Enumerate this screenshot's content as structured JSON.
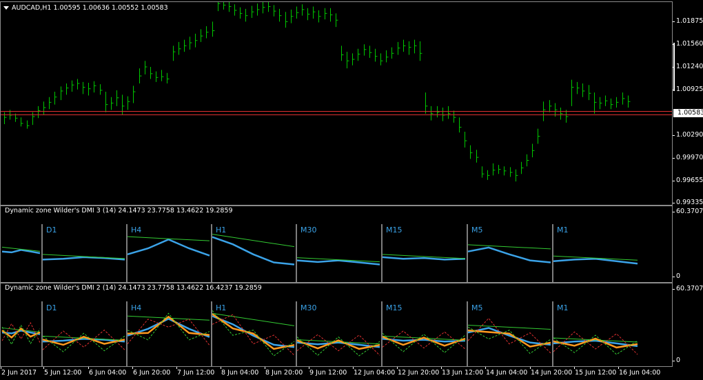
{
  "main": {
    "title": "AUDCAD,H1  1.00595 1.00636 1.00552 1.00583",
    "price_ticks": [
      "1.01875",
      "1.01560",
      "1.01240",
      "1.00925",
      "1.00290",
      "0.99970",
      "0.99655",
      "0.99335"
    ],
    "current_price": "1.00583",
    "candle_color": "#00c800",
    "level_line_color": "#e03030",
    "bars": [
      [
        1.0036,
        1.0052,
        1.0045
      ],
      [
        1.0042,
        1.0055,
        1.0048
      ],
      [
        1.0039,
        1.005,
        1.0044
      ],
      [
        1.0033,
        1.0045,
        1.0037
      ],
      [
        1.003,
        1.0041,
        1.0034
      ],
      [
        1.0035,
        1.0052,
        1.0046
      ],
      [
        1.0044,
        1.006,
        1.0054
      ],
      [
        1.0049,
        1.0066,
        1.0058
      ],
      [
        1.0056,
        1.0072,
        1.0065
      ],
      [
        1.0062,
        1.0079,
        1.0072
      ],
      [
        1.0068,
        1.0086,
        1.008
      ],
      [
        1.0075,
        1.009,
        1.0084
      ],
      [
        1.0079,
        1.0094,
        1.0088
      ],
      [
        1.0082,
        1.0096,
        1.009
      ],
      [
        1.0076,
        1.0092,
        1.0085
      ],
      [
        1.0074,
        1.0091,
        1.0083
      ],
      [
        1.0078,
        1.0093,
        1.0087
      ],
      [
        1.0075,
        1.0089,
        1.0081
      ],
      [
        1.0052,
        1.0079,
        1.0062
      ],
      [
        1.0055,
        1.0072,
        1.0064
      ],
      [
        1.006,
        1.0081,
        1.0071
      ],
      [
        1.0049,
        1.0075,
        1.006
      ],
      [
        1.0055,
        1.0073,
        1.0066
      ],
      [
        1.0064,
        1.0087,
        1.0079
      ],
      [
        1.009,
        1.011,
        1.01
      ],
      [
        1.0102,
        1.012,
        1.0112
      ],
      [
        1.0096,
        1.0112,
        1.0103
      ],
      [
        1.0092,
        1.0106,
        1.0098
      ],
      [
        1.0093,
        1.0108,
        1.0099
      ],
      [
        1.009,
        1.0104,
        1.0096
      ],
      [
        1.012,
        1.014,
        1.0132
      ],
      [
        1.0128,
        1.0145,
        1.0136
      ],
      [
        1.0132,
        1.0148,
        1.014
      ],
      [
        1.0135,
        1.0152,
        1.0144
      ],
      [
        1.0138,
        1.0156,
        1.0147
      ],
      [
        1.0145,
        1.0162,
        1.0153
      ],
      [
        1.015,
        1.0166,
        1.0158
      ],
      [
        1.0152,
        1.0172,
        1.016
      ],
      [
        1.0186,
        1.0204,
        1.0196
      ],
      [
        1.0188,
        1.0203,
        1.0194
      ],
      [
        1.0185,
        1.02,
        1.0192
      ],
      [
        1.018,
        1.0195,
        1.0187
      ],
      [
        1.0176,
        1.0191,
        1.0183
      ],
      [
        1.0172,
        1.0189,
        1.018
      ],
      [
        1.0177,
        1.0193,
        1.0185
      ],
      [
        1.018,
        1.0196,
        1.0188
      ],
      [
        1.0183,
        1.0198,
        1.0191
      ],
      [
        1.0185,
        1.0199,
        1.0192
      ],
      [
        1.0179,
        1.0194,
        1.0186
      ],
      [
        1.0172,
        1.0189,
        1.018
      ],
      [
        1.0164,
        1.0185,
        1.0172
      ],
      [
        1.017,
        1.0188,
        1.0179
      ],
      [
        1.0176,
        1.0192,
        1.0184
      ],
      [
        1.018,
        1.0195,
        1.0188
      ],
      [
        1.0174,
        1.019,
        1.0182
      ],
      [
        1.0176,
        1.0192,
        1.0185
      ],
      [
        1.0171,
        1.0187,
        1.0179
      ],
      [
        1.0175,
        1.019,
        1.0183
      ],
      [
        1.0172,
        1.019,
        1.0181
      ],
      [
        1.0165,
        1.0183,
        1.0174
      ],
      [
        1.012,
        1.014,
        1.0128
      ],
      [
        1.011,
        1.0132,
        1.012
      ],
      [
        1.0114,
        1.013,
        1.0122
      ],
      [
        1.012,
        1.0136,
        1.0129
      ],
      [
        1.0127,
        1.0142,
        1.0135
      ],
      [
        1.0124,
        1.014,
        1.0131
      ],
      [
        1.0119,
        1.0136,
        1.0126
      ],
      [
        1.0114,
        1.013,
        1.012
      ],
      [
        1.0118,
        1.0134,
        1.0125
      ],
      [
        1.0123,
        1.0138,
        1.013
      ],
      [
        1.0128,
        1.0145,
        1.0137
      ],
      [
        1.0132,
        1.0148,
        1.014
      ],
      [
        1.0128,
        1.0146,
        1.0138
      ],
      [
        1.013,
        1.0148,
        1.014
      ],
      [
        1.012,
        1.0146,
        1.013
      ],
      [
        1.005,
        1.0078,
        1.006
      ],
      [
        1.0041,
        1.006,
        1.005
      ],
      [
        1.0045,
        1.006,
        1.0052
      ],
      [
        1.004,
        1.0058,
        1.0048
      ],
      [
        1.0043,
        1.006,
        1.005
      ],
      [
        1.0038,
        1.0054,
        1.0045
      ],
      [
        1.0025,
        1.0045,
        1.0032
      ],
      [
        1.0005,
        1.0026,
        1.0014
      ],
      [
        0.999,
        1.0008,
        0.9998
      ],
      [
        0.9985,
        1.0002,
        0.9992
      ],
      [
        0.9965,
        0.998,
        0.997
      ],
      [
        0.9962,
        0.9975,
        0.9968
      ],
      [
        0.9968,
        0.9984,
        0.9975
      ],
      [
        0.997,
        0.9982,
        0.9976
      ],
      [
        0.9968,
        0.998,
        0.9974
      ],
      [
        0.9966,
        0.9979,
        0.9972
      ],
      [
        0.996,
        0.9976,
        0.9968
      ],
      [
        0.997,
        0.9986,
        0.9978
      ],
      [
        0.998,
        0.9996,
        0.9988
      ],
      [
        0.9992,
        1.001,
        1.0001
      ],
      [
        1.001,
        1.003,
        1.002
      ],
      [
        1.004,
        1.0066,
        1.0055
      ],
      [
        1.0052,
        1.0068,
        1.006
      ],
      [
        1.0046,
        1.0064,
        1.0055
      ],
      [
        1.0042,
        1.0058,
        1.005
      ],
      [
        1.0038,
        1.0055,
        1.0046
      ],
      [
        1.006,
        1.0095,
        1.0085
      ],
      [
        1.0076,
        1.0092,
        1.0084
      ],
      [
        1.0072,
        1.009,
        1.008
      ],
      [
        1.0068,
        1.0088,
        1.0077
      ],
      [
        1.005,
        1.0078,
        1.0065
      ],
      [
        1.0056,
        1.0072,
        1.0064
      ],
      [
        1.006,
        1.0074,
        1.0067
      ],
      [
        1.0056,
        1.007,
        1.0062
      ],
      [
        1.0058,
        1.0072,
        1.0065
      ],
      [
        1.0062,
        1.0078,
        1.007
      ],
      [
        1.0058,
        1.0074,
        1.0066
      ]
    ]
  },
  "indicator1": {
    "title": "Dynamic zone Wilder's DMI 3 (14) 24.1473 23.7758 13.4622 19.2859",
    "scale_top": "60.3707",
    "scale_bottom": "0"
  },
  "indicator2": {
    "title": "Dynamic zone Wilder's DMI 2 (14) 24.1473 23.7758 13.4622 16.4237 19.2859",
    "scale_top": "60.3707",
    "scale_bottom": "0"
  },
  "timeframes": [
    "D1",
    "H4",
    "H1",
    "M30",
    "M15",
    "M5",
    "M1"
  ],
  "series_colors": {
    "dmi": "#3ba3e8",
    "signal": "#ff9a1e",
    "zone": "#33cc33",
    "plus_di": "#e03030",
    "minus_di": "#33cc33"
  },
  "x_labels": [
    "2 Jun 2017",
    "5 Jun 12:00",
    "6 Jun 04:00",
    "6 Jun 20:00",
    "7 Jun 12:00",
    "8 Jun 04:00",
    "8 Jun 20:00",
    "9 Jun 12:00",
    "12 Jun 04:00",
    "12 Jun 20:00",
    "13 Jun 12:00",
    "14 Jun 04:00",
    "14 Jun 20:00",
    "15 Jun 12:00",
    "16 Jun 04:00"
  ]
}
